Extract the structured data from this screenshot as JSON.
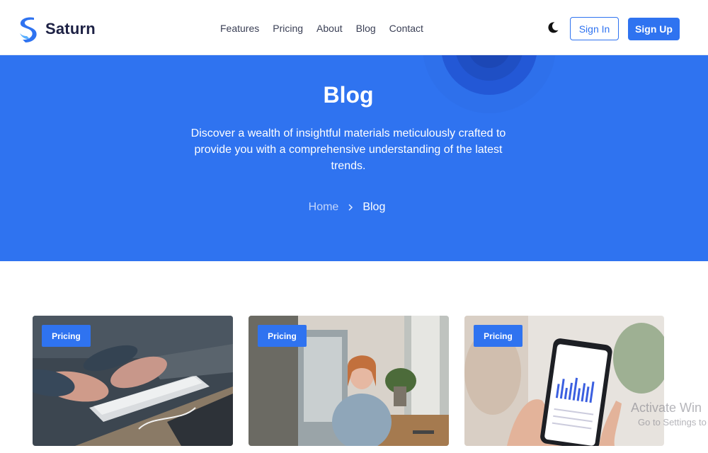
{
  "header": {
    "logo_text": "Saturn",
    "nav": [
      "Features",
      "Pricing",
      "About",
      "Blog",
      "Contact"
    ],
    "theme_icon": "moon-icon",
    "signin_label": "Sign In",
    "signup_label": "Sign Up"
  },
  "hero": {
    "title": "Blog",
    "description": "Discover a wealth of insightful materials meticulously crafted to provide you with a comprehensive understanding of the latest trends.",
    "breadcrumb": {
      "home": "Home",
      "separator_icon": "chevron-right-icon",
      "current": "Blog"
    }
  },
  "posts": [
    {
      "tag": "Pricing",
      "image": "hands-typing-keyboard"
    },
    {
      "tag": "Pricing",
      "image": "smiling-woman-cafe"
    },
    {
      "tag": "Pricing",
      "image": "phone-analytics-chart"
    }
  ],
  "watermark": {
    "line1": "Activate Win",
    "line2": "Go to Settings to"
  },
  "colors": {
    "primary": "#2f73f0",
    "heading_dark": "#1d2144",
    "text_white": "#ffffff"
  }
}
